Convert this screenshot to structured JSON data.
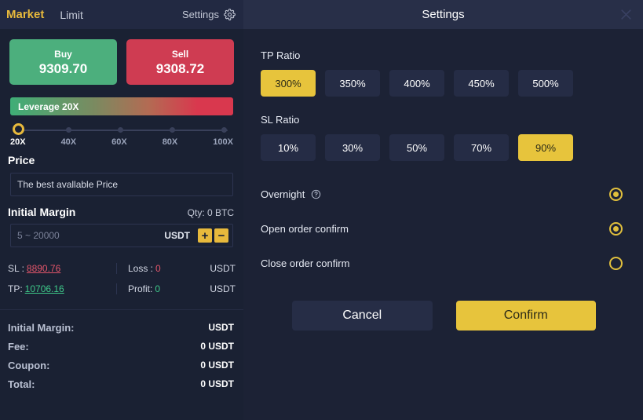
{
  "left_panel": {
    "tabs": [
      {
        "label": "Market",
        "active": true
      },
      {
        "label": "Limit",
        "active": false
      }
    ],
    "settings_link": "Settings",
    "buy": {
      "label": "Buy",
      "price": "9309.70"
    },
    "sell": {
      "label": "Sell",
      "price": "9308.72"
    },
    "leverage": {
      "bar_label": "Leverage 20X",
      "current": "20X",
      "ticks": [
        "20X",
        "40X",
        "60X",
        "80X",
        "100X"
      ]
    },
    "price": {
      "title": "Price",
      "placeholder": "The best avallable Price"
    },
    "initial_margin": {
      "title": "Initial Margin",
      "qty": "Qty: 0 BTC",
      "placeholder": "5 ~ 20000",
      "unit": "USDT",
      "plus": "+",
      "minus": "−"
    },
    "sltp": {
      "sl_label": "SL :",
      "sl_value": "8890.76",
      "loss_label": "Loss :",
      "loss_value": "0",
      "loss_unit": "USDT",
      "tp_label": "TP:",
      "tp_value": "10706.16",
      "profit_label": "Profit:",
      "profit_value": "0",
      "profit_unit": "USDT"
    },
    "summary": [
      {
        "key": "Initial Margin:",
        "value": "USDT"
      },
      {
        "key": "Fee:",
        "value": "0 USDT"
      },
      {
        "key": "Coupon:",
        "value": "0 USDT"
      },
      {
        "key": "Total:",
        "value": "0 USDT"
      }
    ]
  },
  "modal": {
    "title": "Settings",
    "tp_ratio": {
      "label": "TP Ratio",
      "options": [
        "300%",
        "350%",
        "400%",
        "450%",
        "500%"
      ],
      "selected": "300%"
    },
    "sl_ratio": {
      "label": "SL Ratio",
      "options": [
        "10%",
        "30%",
        "50%",
        "70%",
        "90%"
      ],
      "selected": "90%"
    },
    "toggles": [
      {
        "label": "Overnight",
        "on": true,
        "has_help": true
      },
      {
        "label": "Open order confirm",
        "on": true,
        "has_help": false
      },
      {
        "label": "Close order confirm",
        "on": false,
        "has_help": false
      }
    ],
    "cancel_label": "Cancel",
    "confirm_label": "Confirm"
  },
  "colors": {
    "accent_gold": "#e7c43c",
    "buy_green": "#4caf7d",
    "sell_red": "#cf3c52",
    "panel_bg": "#1a2133",
    "modal_bg": "#1c2235"
  }
}
